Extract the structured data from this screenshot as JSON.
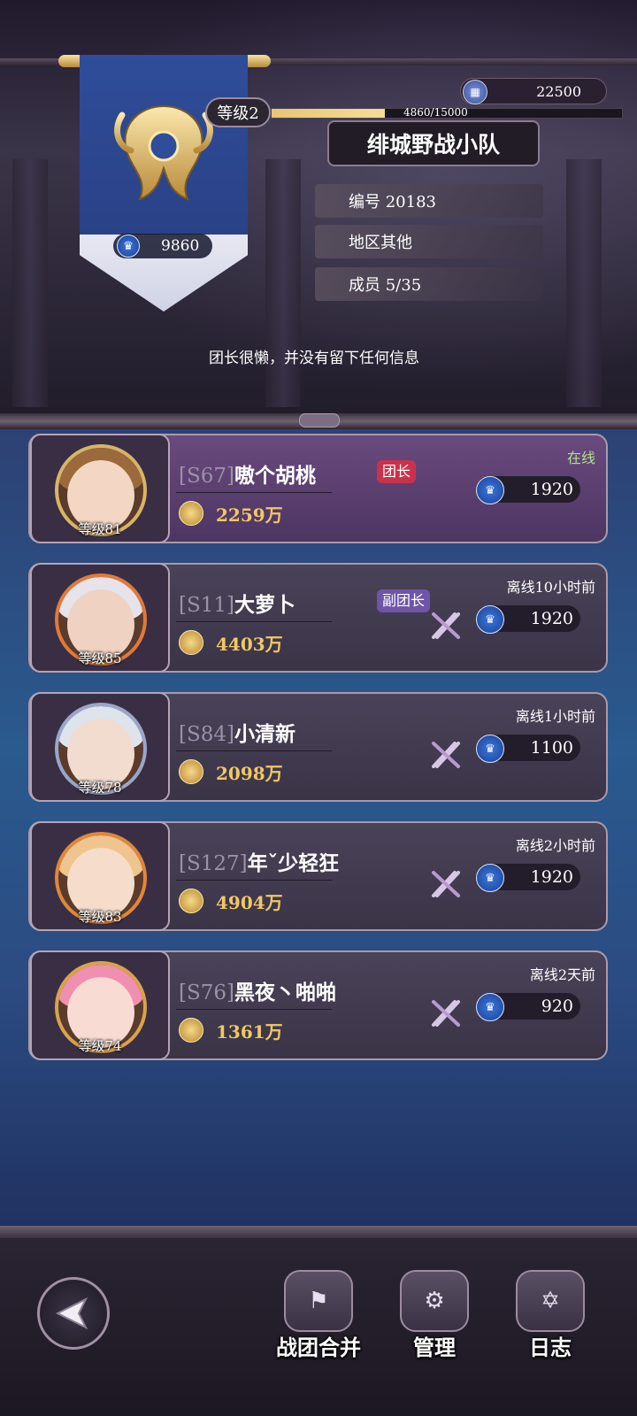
{
  "header": {
    "level_label": "等级2",
    "xp_text": "4860/15000",
    "xp_fraction": 0.324,
    "currency_value": "22500",
    "team_name": "绯城野战小队",
    "crown_value": "9860",
    "id_label": "编号 20183",
    "region_label": "地区其他",
    "members_label": "成员 5/35",
    "motto": "团长很懒，并没有留下任何信息"
  },
  "members": [
    {
      "server": "[S67]",
      "name": "嗷个胡桃",
      "power": "2259万",
      "level": "等级81",
      "role": "团长",
      "status": "在线",
      "crown": "1920"
    },
    {
      "server": "[S11]",
      "name": "大萝卜",
      "power": "4403万",
      "level": "等级85",
      "role": "副团长",
      "status": "离线10小时前",
      "crown": "1920"
    },
    {
      "server": "[S84]",
      "name": "小清新",
      "power": "2098万",
      "level": "等级78",
      "role": "",
      "status": "离线1小时前",
      "crown": "1100"
    },
    {
      "server": "[S127]",
      "name": "年ˇ少轻狂",
      "power": "4904万",
      "level": "等级83",
      "role": "",
      "status": "离线2小时前",
      "crown": "1920"
    },
    {
      "server": "[S76]",
      "name": "黑夜丶啪啪",
      "power": "1361万",
      "level": "等级74",
      "role": "",
      "status": "离线2天前",
      "crown": "920"
    }
  ],
  "nav": {
    "merge_label": "战团合并",
    "manage_label": "管理",
    "log_label": "日志"
  },
  "colors": {
    "power_gold": "#f0c865",
    "leader_badge": "#c9324c",
    "vice_badge": "#6e55a8",
    "online_text": "#aee08a"
  }
}
